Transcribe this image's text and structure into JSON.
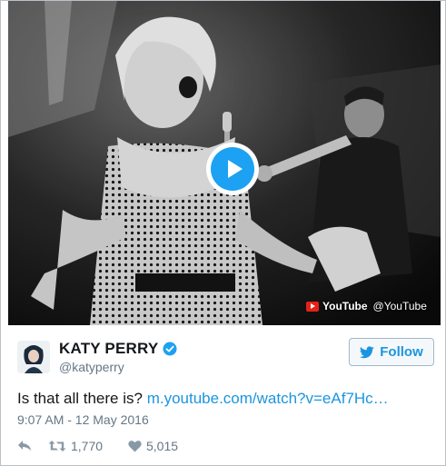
{
  "media": {
    "type": "video",
    "watermark_brand": "YouTube",
    "watermark_handle": "@YouTube"
  },
  "author": {
    "display_name": "KATY PERRY",
    "handle": "@katyperry",
    "verified": true
  },
  "follow_button": {
    "label": "Follow"
  },
  "tweet": {
    "text": "Is that all there is? ",
    "link_text": "m.youtube.com/watch?v=eAf7Hc…",
    "timestamp": "9:07 AM - 12 May 2016"
  },
  "actions": {
    "retweets": "1,770",
    "likes": "5,015"
  },
  "colors": {
    "link": "#1b95e0",
    "play_button": "#1da1f2",
    "muted_text": "#657786"
  }
}
